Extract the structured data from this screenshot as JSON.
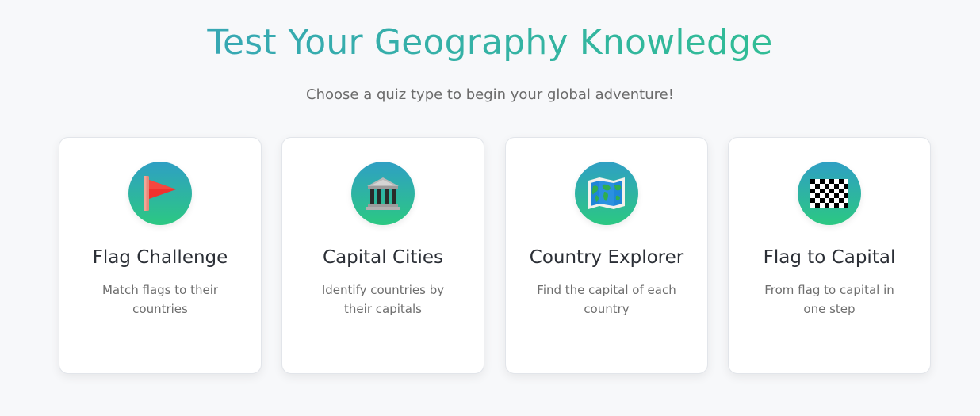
{
  "header": {
    "title": "Test Your Geography Knowledge",
    "subtitle": "Choose a quiz type to begin your global adventure!"
  },
  "cards": [
    {
      "icon": "triangular-flag-icon",
      "title": "Flag Challenge",
      "description": "Match flags to their countries"
    },
    {
      "icon": "classical-building-icon",
      "title": "Capital Cities",
      "description": "Identify countries by their capitals"
    },
    {
      "icon": "world-map-icon",
      "title": "Country Explorer",
      "description": "Find the capital of each country"
    },
    {
      "icon": "checkered-flag-icon",
      "title": "Flag to Capital",
      "description": "From flag to capital in one step"
    }
  ],
  "colors": {
    "title_gradient_start": "#3aa0bf",
    "title_gradient_end": "#2ec48a",
    "icon_gradient_start": "#2f9fc4",
    "icon_gradient_end": "#2cc882",
    "background": "#f7f8fa"
  }
}
